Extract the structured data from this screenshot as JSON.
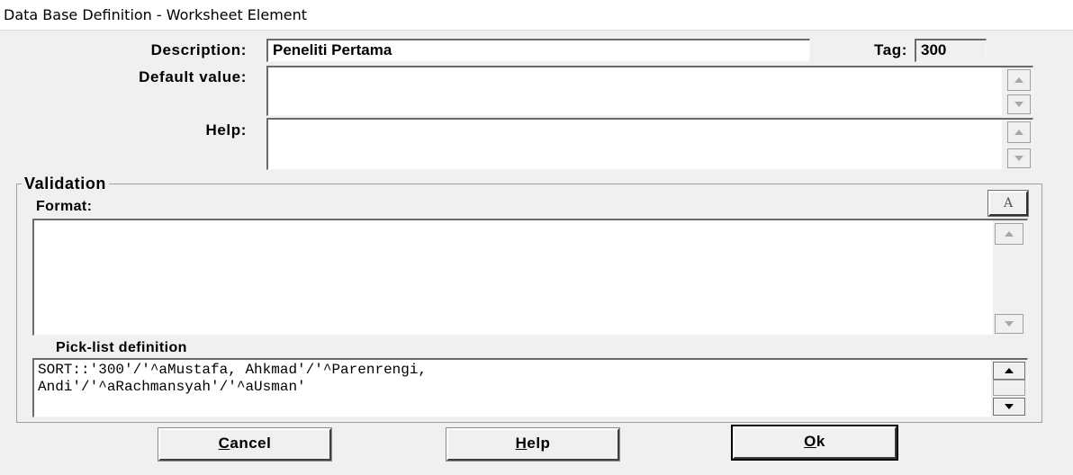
{
  "window": {
    "title": "Data Base Definition - Worksheet Element"
  },
  "fields": {
    "description_label": "Description:",
    "description_value": "Peneliti Pertama",
    "tag_label": "Tag:",
    "tag_value": "300",
    "default_label": "Default value:",
    "default_value": "",
    "help_label": "Help:",
    "help_value": ""
  },
  "validation": {
    "title": "Validation",
    "format_label": "Format:",
    "format_value": "",
    "font_button": "A",
    "picklist_label": "Pick-list definition",
    "picklist_value": "SORT::'300'/'^aMustafa, Ahkmad'/'^Parenrengi,\nAndi'/'^aRachmansyah'/'^aUsman'"
  },
  "buttons": {
    "cancel": {
      "accel": "C",
      "rest": "ancel"
    },
    "help": {
      "accel": "H",
      "rest": "elp"
    },
    "ok": {
      "accel": "O",
      "rest": "k"
    }
  }
}
